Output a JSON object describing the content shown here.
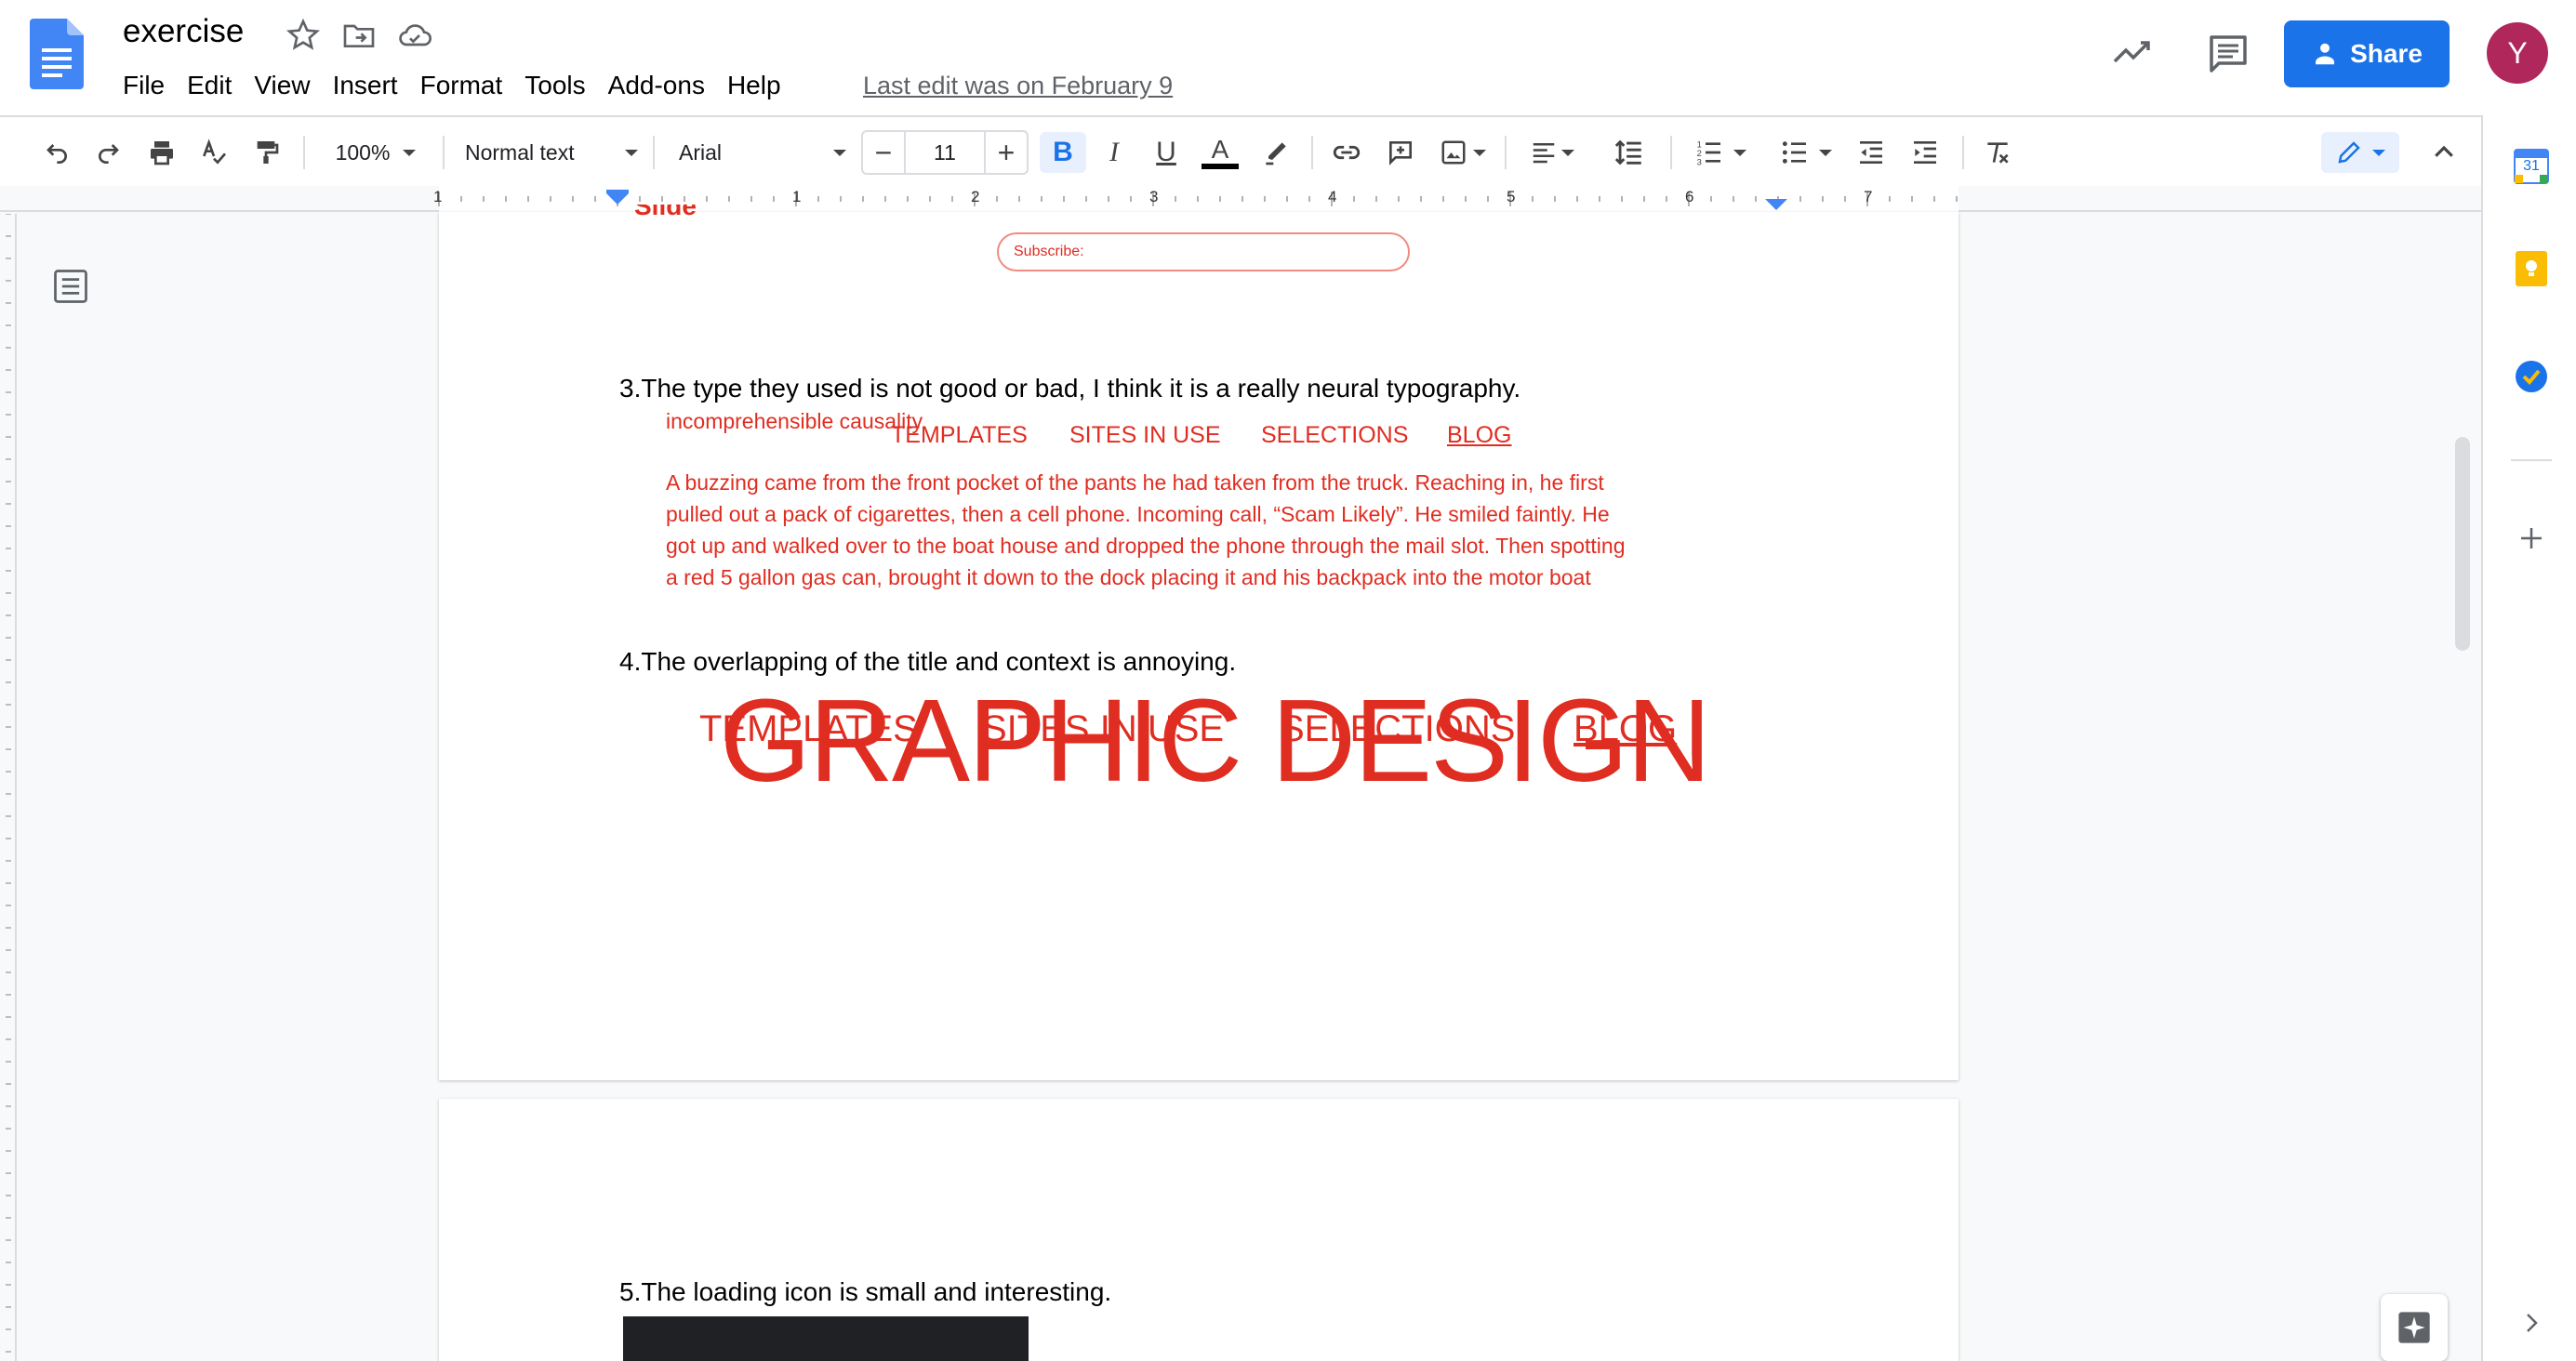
{
  "app": {
    "doc_title": "exercise",
    "last_edit": "Last edit was on February 9",
    "menu": [
      "File",
      "Edit",
      "View",
      "Insert",
      "Format",
      "Tools",
      "Add-ons",
      "Help"
    ],
    "share_label": "Share",
    "avatar_initial": "Y",
    "brand_color": "#1a73e8",
    "avatar_color": "#b0275b"
  },
  "toolbar": {
    "zoom": "100%",
    "style": "Normal text",
    "font": "Arial",
    "font_size": "11",
    "bold_label": "B",
    "italic_label": "I",
    "underline_label": "U",
    "text_color_label": "A",
    "minus": "−",
    "plus": "+"
  },
  "ruler": {
    "marks": [
      "1",
      "1",
      "2",
      "3",
      "4",
      "5",
      "6",
      "7"
    ]
  },
  "side_panel": {
    "calendar_day": "31"
  },
  "document": {
    "cut_off_top": "Slide",
    "subscribe_placeholder": "Subscribe:",
    "item3": "3.The type they used is not good or bad, I think it is a really neural typography.",
    "causality": "incomprehensible causality.",
    "nav_small": [
      "TEMPLATES",
      "SITES IN USE",
      "SELECTIONS",
      "BLOG"
    ],
    "paragraph": [
      "A buzzing came from the front pocket of the pants he had taken from the truck. Reaching in, he first",
      "pulled out a pack of cigarettes, then a cell phone. Incoming call, “Scam Likely”. He smiled faintly. He",
      "got up and walked over to the boat house and dropped the phone through the mail slot. Then spotting",
      "a red 5 gallon gas can, brought it down to the dock placing it and his backpack into the motor boat"
    ],
    "item4": "4.The overlapping of the title and context is annoying.",
    "nav_large": [
      "TEMPLATES",
      "SITES IN USE",
      "SELECTIONS",
      "BLOG"
    ],
    "big_title": "GRAPHIC DESIGN",
    "item5": "5.The loading icon is small and interesting.",
    "accent_red": "#e02d21"
  }
}
